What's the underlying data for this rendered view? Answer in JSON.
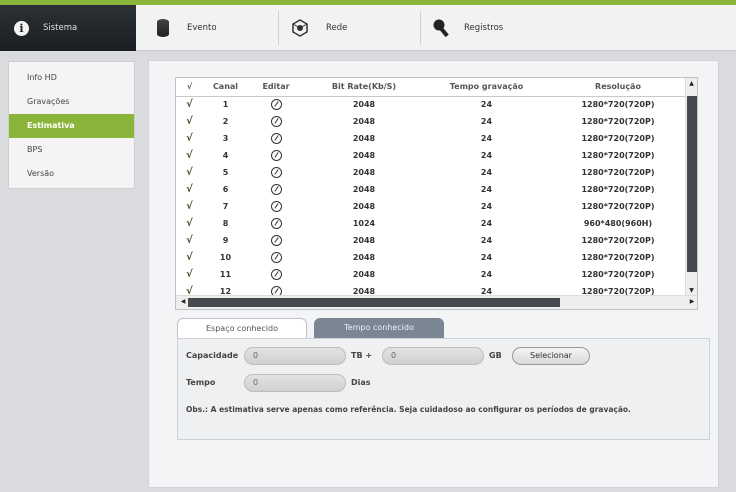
{
  "nav": {
    "tabs": [
      {
        "label": "Sistema",
        "icon": "info-icon",
        "active": true
      },
      {
        "label": "Evento",
        "icon": "database-icon"
      },
      {
        "label": "Rede",
        "icon": "network-camera-icon"
      },
      {
        "label": "Registros",
        "icon": "search-log-icon"
      }
    ]
  },
  "sidebar": {
    "items": [
      {
        "label": "Info HD"
      },
      {
        "label": "Gravações"
      },
      {
        "label": "Estimativa",
        "active": true
      },
      {
        "label": "BPS"
      },
      {
        "label": "Versão"
      }
    ]
  },
  "table": {
    "headers": {
      "check": "√",
      "canal": "Canal",
      "editar": "Editar",
      "bitrate": "Bit Rate(Kb/S)",
      "tempo": "Tempo gravação",
      "resolucao": "Resolução"
    },
    "rows": [
      {
        "check": "√",
        "canal": "1",
        "bitrate": "2048",
        "tempo": "24",
        "resolucao": "1280*720(720P)"
      },
      {
        "check": "√",
        "canal": "2",
        "bitrate": "2048",
        "tempo": "24",
        "resolucao": "1280*720(720P)"
      },
      {
        "check": "√",
        "canal": "3",
        "bitrate": "2048",
        "tempo": "24",
        "resolucao": "1280*720(720P)"
      },
      {
        "check": "√",
        "canal": "4",
        "bitrate": "2048",
        "tempo": "24",
        "resolucao": "1280*720(720P)"
      },
      {
        "check": "√",
        "canal": "5",
        "bitrate": "2048",
        "tempo": "24",
        "resolucao": "1280*720(720P)"
      },
      {
        "check": "√",
        "canal": "6",
        "bitrate": "2048",
        "tempo": "24",
        "resolucao": "1280*720(720P)"
      },
      {
        "check": "√",
        "canal": "7",
        "bitrate": "2048",
        "tempo": "24",
        "resolucao": "1280*720(720P)"
      },
      {
        "check": "√",
        "canal": "8",
        "bitrate": "1024",
        "tempo": "24",
        "resolucao": "960*480(960H)"
      },
      {
        "check": "√",
        "canal": "9",
        "bitrate": "2048",
        "tempo": "24",
        "resolucao": "1280*720(720P)"
      },
      {
        "check": "√",
        "canal": "10",
        "bitrate": "2048",
        "tempo": "24",
        "resolucao": "1280*720(720P)"
      },
      {
        "check": "√",
        "canal": "11",
        "bitrate": "2048",
        "tempo": "24",
        "resolucao": "1280*720(720P)"
      },
      {
        "check": "√",
        "canal": "12",
        "bitrate": "2048",
        "tempo": "24",
        "resolucao": "1280*720(720P)"
      }
    ]
  },
  "estimate": {
    "tab_known_space": "Espaço conhecido",
    "tab_known_time": "Tempo conhecido",
    "capacity_label": "Capacidade",
    "capacity_tb_value": "0",
    "unit_tb": "TB +",
    "capacity_gb_value": "0",
    "unit_gb": "GB",
    "select_button": "Selecionar",
    "time_label": "Tempo",
    "time_value": "0",
    "unit_days": "Dias",
    "note": "Obs.: A estimativa serve apenas como referência. Seja cuidadoso ao configurar os períodos de gravação."
  },
  "colors": {
    "accent": "#8ab53a",
    "dark_header": "#1b1f23",
    "scroll_thumb": "#444a50"
  }
}
